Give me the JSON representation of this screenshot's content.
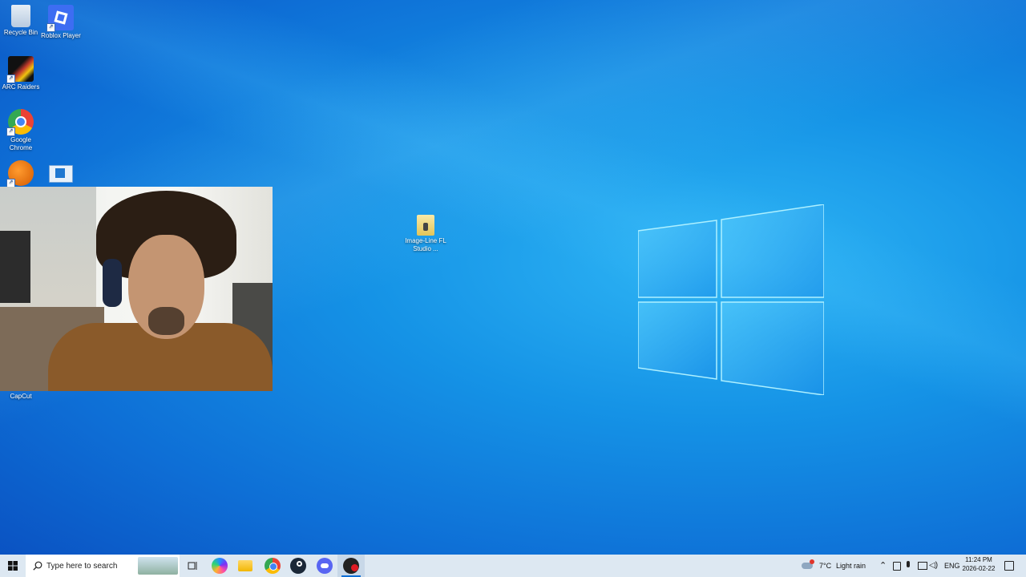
{
  "desktop": {
    "icons": [
      {
        "label": "Recycle Bin"
      },
      {
        "label": "Roblox Player"
      },
      {
        "label": "ARC Raiders"
      },
      {
        "label": "Google Chrome"
      },
      {
        "label": "CapCut"
      },
      {
        "label": "Image-Line FL Studio ..."
      }
    ]
  },
  "taskbar": {
    "search_placeholder": "Type here to search",
    "weather": {
      "temp": "7°C",
      "condition": "Light rain"
    },
    "language": "ENG",
    "time": "11:24 PM",
    "date": "2026-02-22"
  },
  "colors": {
    "accent": "#0e6fd6",
    "taskbar": "#dde8f2"
  }
}
